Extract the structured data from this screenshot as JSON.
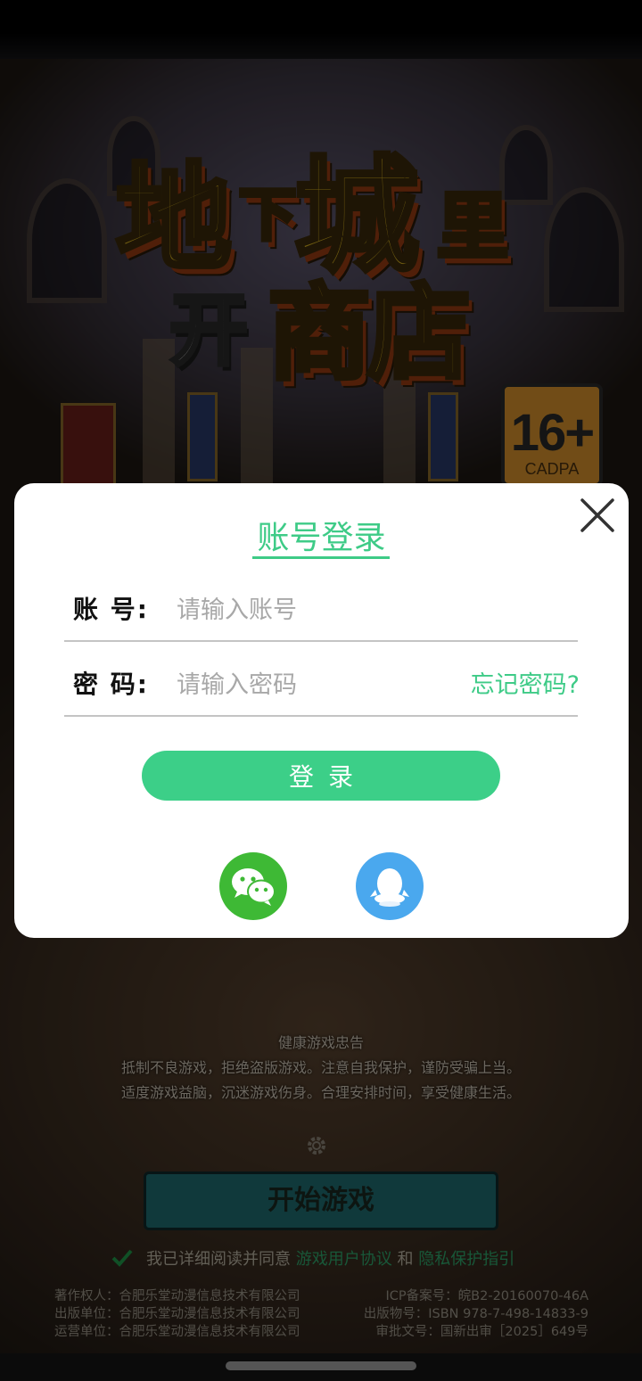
{
  "logo": {
    "line1_a": "地",
    "line1_b": "下",
    "line1_c": "城",
    "line1_d": "里",
    "line2_a": "开",
    "line2_b": "商店"
  },
  "age_rating": {
    "label": "16+",
    "org": "CADPA"
  },
  "login_modal": {
    "title": "账号登录",
    "account_label": "账  号:",
    "account_placeholder": "请输入账号",
    "password_label": "密  码:",
    "password_placeholder": "请输入密码",
    "forgot_password": "忘记密码?",
    "login_button": "登录",
    "social": [
      "wechat-login",
      "qq-login"
    ]
  },
  "notice": {
    "title": "健康游戏忠告",
    "line1": "抵制不良游戏，拒绝盗版游戏。注意自我保护，谨防受骗上当。",
    "line2": "适度游戏益脑，沉迷游戏伤身。合理安排时间，享受健康生活。"
  },
  "start_button": "开始游戏",
  "agreement": {
    "prefix": "我已详细阅读并同意",
    "user_agreement": "游戏用户协议",
    "and": "和",
    "privacy": "隐私保护指引"
  },
  "footer_left": [
    "著作权人：合肥乐堂动漫信息技术有限公司",
    "出版单位：合肥乐堂动漫信息技术有限公司",
    "运营单位：合肥乐堂动漫信息技术有限公司"
  ],
  "footer_right": [
    "ICP备案号：皖B2-20160070-46A",
    "出版物号：ISBN 978-7-498-14833-9",
    "审批文号：国新出审［2025］649号"
  ],
  "colors": {
    "accent": "#3ecb87",
    "wechat": "#3eb935",
    "qq": "#4aa8ee"
  }
}
